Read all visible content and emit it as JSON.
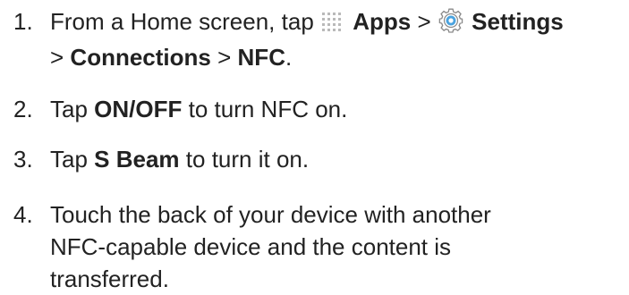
{
  "steps": [
    {
      "number": "1.",
      "pre": "From a Home screen, tap",
      "apps_icon": "apps-grid-icon",
      "apps": "Apps",
      "sep1": ">",
      "settings_icon": "settings-gear-icon",
      "settings": "Settings",
      "sep2": ">",
      "connections": "Connections",
      "sep3": ">",
      "nfc": "NFC",
      "end": "."
    },
    {
      "number": "2.",
      "pre": "Tap",
      "bold": "ON/OFF",
      "post": "to turn NFC on."
    },
    {
      "number": "3.",
      "pre": "Tap",
      "bold": "S Beam",
      "post": "to turn it on."
    },
    {
      "number": "4.",
      "line1": "Touch the back of your device with another",
      "line2": "NFC-capable device and the content is",
      "line3": "transferred."
    }
  ]
}
